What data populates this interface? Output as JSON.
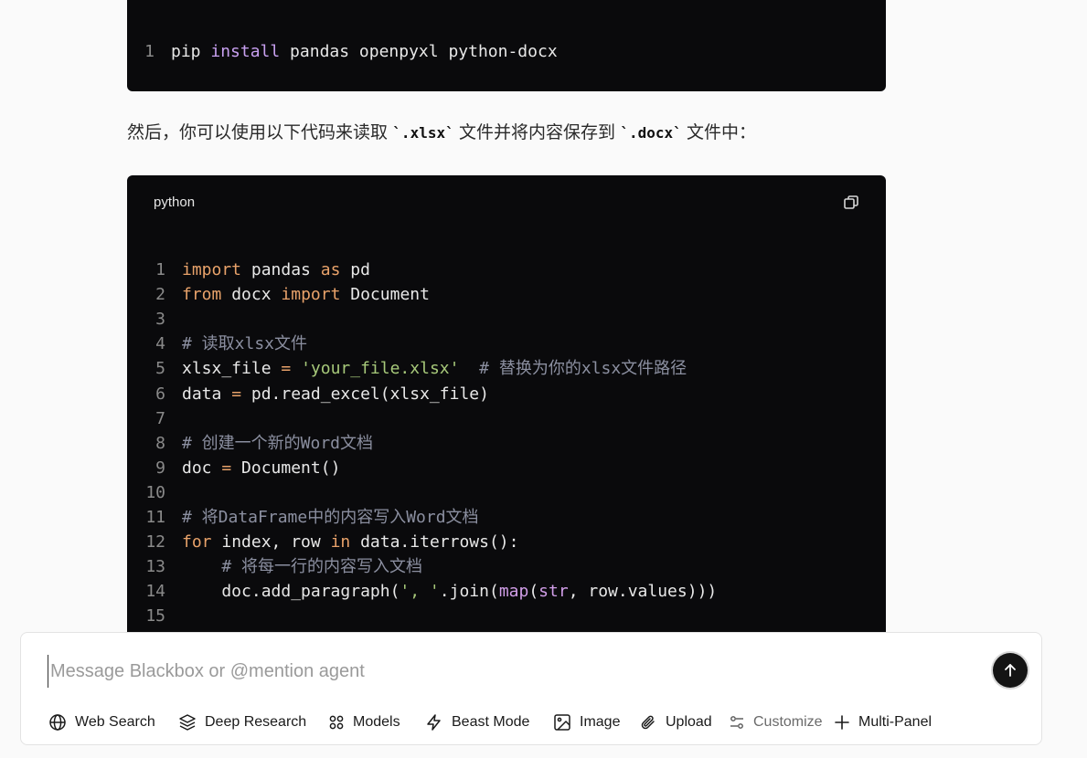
{
  "block1": {
    "lines": [
      {
        "n": "1",
        "segments": [
          {
            "t": "pip ",
            "c": ""
          },
          {
            "t": "install",
            "c": "kw2"
          },
          {
            "t": " pandas openpyxl python-docx",
            "c": ""
          }
        ]
      }
    ]
  },
  "prose": {
    "part1": "然后，你可以使用以下代码来读取",
    "code1": "`.xlsx`",
    "part2": "文件并将内容保存到",
    "code2": "`.docx`",
    "part3": "文件中："
  },
  "block2": {
    "language": "python",
    "lines": [
      {
        "n": "1",
        "segments": [
          {
            "t": "import",
            "c": "kw"
          },
          {
            "t": " pandas ",
            "c": ""
          },
          {
            "t": "as",
            "c": "kw"
          },
          {
            "t": " pd",
            "c": ""
          }
        ]
      },
      {
        "n": "2",
        "segments": [
          {
            "t": "from",
            "c": "kw"
          },
          {
            "t": " docx ",
            "c": ""
          },
          {
            "t": "import",
            "c": "kw"
          },
          {
            "t": " Document",
            "c": ""
          }
        ]
      },
      {
        "n": "3",
        "segments": []
      },
      {
        "n": "4",
        "segments": [
          {
            "t": "# 读取xlsx文件",
            "c": "com"
          }
        ]
      },
      {
        "n": "5",
        "segments": [
          {
            "t": "xlsx_file ",
            "c": ""
          },
          {
            "t": "=",
            "c": "kw"
          },
          {
            "t": " ",
            "c": ""
          },
          {
            "t": "'your_file.xlsx'",
            "c": "str"
          },
          {
            "t": "  ",
            "c": ""
          },
          {
            "t": "# 替换为你的xlsx文件路径",
            "c": "com"
          }
        ]
      },
      {
        "n": "6",
        "segments": [
          {
            "t": "data ",
            "c": ""
          },
          {
            "t": "=",
            "c": "kw"
          },
          {
            "t": " pd.read_excel(xlsx_file)",
            "c": ""
          }
        ]
      },
      {
        "n": "7",
        "segments": []
      },
      {
        "n": "8",
        "segments": [
          {
            "t": "# 创建一个新的Word文档",
            "c": "com"
          }
        ]
      },
      {
        "n": "9",
        "segments": [
          {
            "t": "doc ",
            "c": ""
          },
          {
            "t": "=",
            "c": "kw"
          },
          {
            "t": " Document()",
            "c": ""
          }
        ]
      },
      {
        "n": "10",
        "segments": []
      },
      {
        "n": "11",
        "segments": [
          {
            "t": "# 将DataFrame中的内容写入Word文档",
            "c": "com"
          }
        ]
      },
      {
        "n": "12",
        "segments": [
          {
            "t": "for",
            "c": "kw"
          },
          {
            "t": " index, row ",
            "c": ""
          },
          {
            "t": "in",
            "c": "kw"
          },
          {
            "t": " data.iterrows():",
            "c": ""
          }
        ]
      },
      {
        "n": "13",
        "segments": [
          {
            "t": "    ",
            "c": ""
          },
          {
            "t": "# 将每一行的内容写入文档",
            "c": "com"
          }
        ]
      },
      {
        "n": "14",
        "segments": [
          {
            "t": "    doc.add_paragraph(",
            "c": ""
          },
          {
            "t": "', '",
            "c": "str"
          },
          {
            "t": ".join(",
            "c": ""
          },
          {
            "t": "map",
            "c": "fn"
          },
          {
            "t": "(",
            "c": ""
          },
          {
            "t": "str",
            "c": "fn"
          },
          {
            "t": ", row.values)))",
            "c": ""
          }
        ]
      },
      {
        "n": "15",
        "segments": []
      }
    ]
  },
  "composer": {
    "placeholder": "Message Blackbox or @mention agent",
    "send_icon": "arrow-up-icon",
    "tools": [
      {
        "label": "Web Search",
        "icon": "globe-icon"
      },
      {
        "label": "Deep Research",
        "icon": "layers-icon"
      },
      {
        "label": "Models",
        "icon": "grid-dots-icon"
      },
      {
        "label": "Beast Mode",
        "icon": "lightning-icon"
      },
      {
        "label": "Image",
        "icon": "image-icon"
      },
      {
        "label": "Upload",
        "icon": "paperclip-icon"
      },
      {
        "label": "Customize",
        "icon": "sliders-icon"
      },
      {
        "label": "Multi-Panel",
        "icon": "plus-icon"
      }
    ]
  }
}
